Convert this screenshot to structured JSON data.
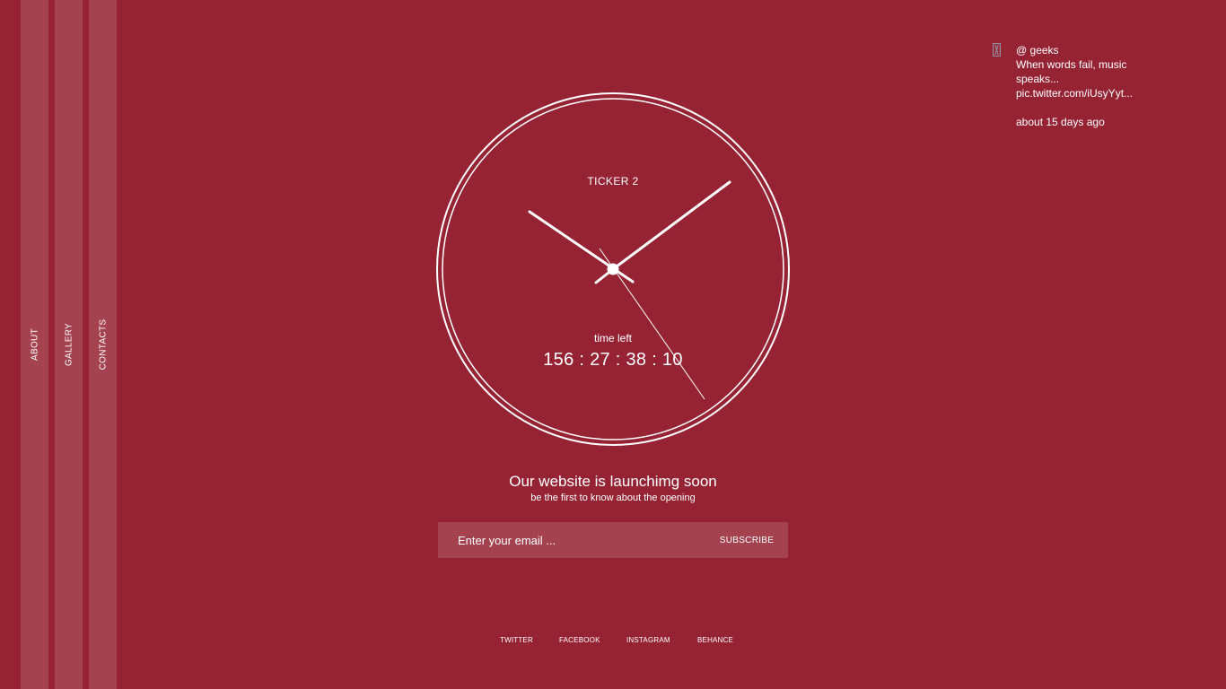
{
  "nav": {
    "items": [
      {
        "label": "ABOUT"
      },
      {
        "label": "GALLERY"
      },
      {
        "label": "CONTACTS"
      }
    ]
  },
  "tweet": {
    "icon": "twitter-icon",
    "handle": "@ geeks",
    "text_lines": [
      "When words fail, music",
      "speaks...",
      "pic.twitter.com/iUsyYyt..."
    ],
    "time": "about 15 days ago"
  },
  "clock": {
    "label": "TICKER 2",
    "time_left_label": "time left",
    "countdown": "156 : 27 : 38 : 10"
  },
  "launch": {
    "headline": "Our website is launchimg soon",
    "subline": "be the first to know about the opening"
  },
  "subscribe": {
    "placeholder": "Enter your email ...",
    "button_label": "SUBSCRIBE"
  },
  "social": {
    "twitter": "TWITTER",
    "facebook": "FACEBOOK",
    "instagram": "INSTAGRAM",
    "behance": "BEHANCE"
  },
  "colors": {
    "background": "#962333",
    "foreground": "#ffffff"
  }
}
